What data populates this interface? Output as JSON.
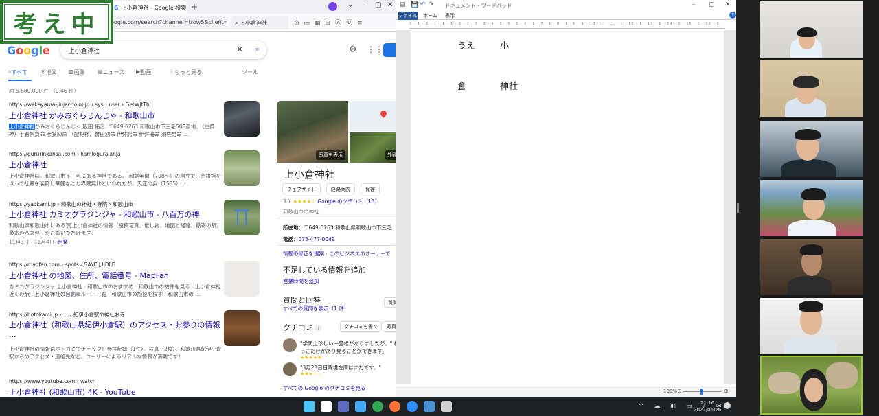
{
  "overlay": {
    "thinking_badge": "考え中"
  },
  "browser": {
    "tab_title": "上小倉神社 - Google 検索",
    "url": "google.com/search?channel=trow5&client=",
    "toolbar_search": "上小倉神社",
    "google": {
      "logo": [
        "G",
        "o",
        "o",
        "g",
        "l",
        "e"
      ],
      "query": "上小倉神社",
      "tabs": [
        "すべて",
        "地図",
        "画像",
        "ニュース",
        "動画",
        "もっと見る",
        "ツール"
      ],
      "result_count": "約 5,680,000 件 （0.46 秒）",
      "results": [
        {
          "url": "https://wakayama-jinjacho.or.jp › sys › user › GetWjtTbl",
          "title": "上小倉神社 かみおぐらじんじゃ - 和歌山市",
          "highlight": "上小倉神社",
          "snippet": "かみおぐらじんじゃ 阪田 拓治. 〒649-6263 和歌山市下三毛508番地. （主祭神）手置帆負命 彦狭知命 （配祀神）誉田別命 伊弉諾命 伊弉冊命 須佐男命 ..."
        },
        {
          "url": "https://gururinkansai.com › kamiogurajanja",
          "title": "上小倉神社",
          "snippet": "上小倉神社は、和歌山市下三毛にある神社である。 和銅年間（708～）の創立で、金銀鋲を以って社殿を装飾し華麗なこと界隈無比といわれたが、天正の兵（1585） ..."
        },
        {
          "url": "https://yaokami.jp › 和歌山の神社・寺院 › 和歌山市",
          "title": "上小倉神社 カミオグラジンジャ - 和歌山市 - 八百万の神",
          "snippet": "和歌山県和歌山市にある⛩上小倉神社の情報（投稿写真、催し物、地図と経路、最寄の駅、最寄のバス停）がご覧いただけます。",
          "extra": "11月3日 - 11月4日",
          "extra_link": "例祭"
        },
        {
          "url": "https://mapfan.com › spots › SAYC,J,IIDLE",
          "title": "上小倉神社 の地図、住所、電話番号 - MapFan",
          "snippet": "カミコグラジンジャ 上小倉神社 · 和歌山市のおすすめ · 和歌山市の物件を見る · 上小倉神社近くの駅 · 上小倉神社の自動車ルート一覧 · 和歌山市の施設を探す · 和歌山市の ..."
        },
        {
          "url": "https://hotokami.jp › ... › 紀伊小倉駅の神社お寺",
          "title": "上小倉神社（和歌山県紀伊小倉駅）のアクセス・お参りの情報 ...",
          "snippet": "上小倉神社の情報はホトカミでチェック！参拝記録（1件）、写真（2枚）、和歌山県紀伊小倉駅からのアクセス・連絡先など、ユーザーによるリアルな情報が満載です！"
        },
        {
          "url": "https://www.youtube.com › watch",
          "title": "上小倉神社 (和歌山市) 4K - YouTube",
          "snippet": ""
        }
      ],
      "panel": {
        "photos_label": "写真を表示",
        "outside_label": "外観",
        "title": "上小倉神社",
        "buttons": [
          "ウェブサイト",
          "経路案内",
          "保存"
        ],
        "rating": "3.7",
        "stars": "★★★★☆",
        "reviews_link": "Google のクチコミ（13）",
        "category": "和歌山市の神社",
        "address_label": "所在地：",
        "address": "〒649-6263 和歌山県和歌山市下三毛",
        "phone_label": "電話：",
        "phone": "073-477-0049",
        "edit_link": "情報の修正を提案 · このビジネスのオーナーで",
        "missing_heading": "不足している情報を追加",
        "missing_link": "営業時間を追加",
        "qa_heading": "質問と回答",
        "qa_link": "すべての質問を表示（1 件）",
        "qa_button": "質問",
        "reviews_heading": "クチコミ",
        "write_review": "クチコミを書く",
        "photo_button": "写真",
        "reviews": [
          {
            "text": "\"学問上珍しい一畳松がありましたが、\" 根っこだけがあり見ることができます。",
            "stars": "★★★★★"
          },
          {
            "text": "\"3月23日日曜境在庫はまだです。\"",
            "stars": "★★★☆☆"
          }
        ],
        "all_reviews": "すべての Google のクチコミを見る"
      }
    }
  },
  "word": {
    "title": "ドキュメント - ワードパッド",
    "ribbon_tabs": [
      "ファイル",
      "ホーム",
      "表示"
    ],
    "ruler": "3 · 1 · 2 · 1 · 1 · 1 · 2 · 1 · 3 · 1 · 4 · 1 · 5 · 1 · 6 · 1 · 7 · 1 · 8 · 1 · 9 · 1 · 10 · 1 · 11 · 1 · 12 · 1 · 13 · 1 · 14 · 1 · 15 · 1 · 16 · 1 · 17 · 1 · 18",
    "lines": [
      {
        "a": "うえ",
        "b": "小"
      },
      {
        "a": "倉",
        "b": "神社"
      }
    ],
    "zoom": "100%"
  },
  "taskbar": {
    "time": "21:16",
    "date": "2022/05/26",
    "tray": "^ ☁ ◐ ▭ ♪ ✉",
    "app_colors": [
      "#4cc2ff",
      "#ffffff",
      "#5c6bc0",
      "#3fa9f5",
      "#34a853",
      "#ff7139",
      "#2d8cff",
      "#4a90d9",
      "#cfcfcf"
    ]
  }
}
